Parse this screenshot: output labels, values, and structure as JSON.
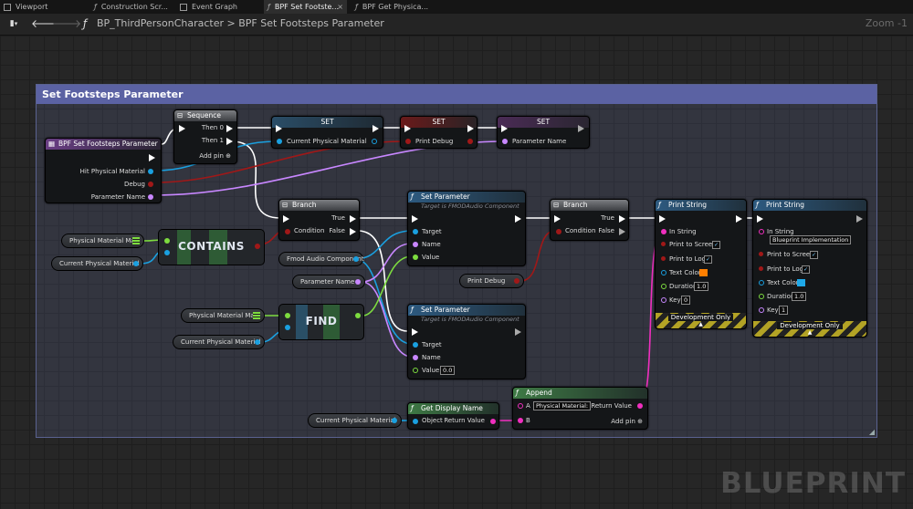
{
  "tabs": [
    {
      "label": "Viewport",
      "active": false
    },
    {
      "label": "Construction Scr...",
      "active": false
    },
    {
      "label": "Event Graph",
      "active": false
    },
    {
      "label": "BPF Set Footste...",
      "active": true
    },
    {
      "label": "BPF Get Physica...",
      "active": false
    }
  ],
  "tab_close": "×",
  "breadcrumb": {
    "root": "BP_ThirdPersonCharacter",
    "separator": ">",
    "current": "BPF Set Footsteps Parameter"
  },
  "zoom": "Zoom -1",
  "comment_title": "Set Footsteps Parameter",
  "entry": {
    "title": "BPF Set Footsteps Parameter",
    "pins": [
      "Hit Physical Material",
      "Debug",
      "Parameter Name"
    ]
  },
  "sequence": {
    "title": "Sequence",
    "then0": "Then 0",
    "then1": "Then 1",
    "add_pin": "Add pin"
  },
  "set1": {
    "title": "SET",
    "pin": "Current Physical Material"
  },
  "set2": {
    "title": "SET",
    "pin": "Print Debug"
  },
  "set3": {
    "title": "SET",
    "pin": "Parameter Name"
  },
  "branch1": {
    "title": "Branch",
    "condition": "Condition",
    "true": "True",
    "false": "False"
  },
  "contains": {
    "label": "CONTAINS"
  },
  "find": {
    "label": "FIND"
  },
  "vars": {
    "pmm1": "Physical Material Map",
    "cpm1": "Current Physical Material",
    "fmod": "Fmod Audio Component",
    "pname": "Parameter Name",
    "pmm2": "Physical Material Map",
    "cpm2": "Current Physical Material",
    "cpm3": "Current Physical Material",
    "pdebug": "Print Debug"
  },
  "setparam1": {
    "title": "Set Parameter",
    "subtitle": "Target is FMODAudio Component",
    "target": "Target",
    "name": "Name",
    "value": "Value"
  },
  "setparam2": {
    "title": "Set Parameter",
    "subtitle": "Target is FMODAudio Component",
    "target": "Target",
    "name": "Name",
    "value": "Value",
    "value_default": "0.0"
  },
  "branch2": {
    "title": "Branch",
    "condition": "Condition",
    "true": "True",
    "false": "False"
  },
  "print1": {
    "title": "Print String",
    "in_string": "In String",
    "print_to_screen": "Print to Screen",
    "print_to_log": "Print to Log",
    "text_color": "Text Color",
    "text_color_value": "#ff7f00",
    "duration": "Duration",
    "duration_value": "1.0",
    "key": "Key",
    "key_value": "0",
    "dev": "Development Only"
  },
  "print2": {
    "title": "Print String",
    "in_string": "In String",
    "in_string_value": "Blueprint Implementation",
    "print_to_screen": "Print to Screen",
    "print_to_log": "Print to Log",
    "text_color": "Text Color",
    "text_color_value": "#1ea8e8",
    "duration": "Duration",
    "duration_value": "1.0",
    "key": "Key",
    "key_value": "1",
    "dev": "Development Only"
  },
  "getdisplay": {
    "title": "Get Display Name",
    "object": "Object",
    "return": "Return Value"
  },
  "append": {
    "title": "Append",
    "a": "A",
    "a_value": "Physical Material:",
    "b": "B",
    "return": "Return Value",
    "add_pin": "Add pin"
  },
  "watermark": "BLUEPRINT"
}
